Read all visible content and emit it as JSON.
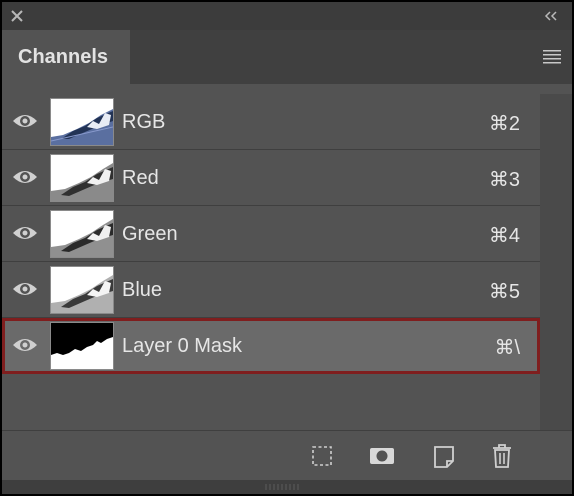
{
  "panel": {
    "tab_label": "Channels",
    "icons": {
      "close": "close-icon",
      "collapse": "double-chevron-left-icon",
      "menu": "hamburger-menu-icon"
    }
  },
  "channels": [
    {
      "name": "RGB",
      "shortcut": "⌘2",
      "visible": true,
      "thumbnail": "color-landscape",
      "selected": false
    },
    {
      "name": "Red",
      "shortcut": "⌘3",
      "visible": true,
      "thumbnail": "grayscale-landscape",
      "selected": false
    },
    {
      "name": "Green",
      "shortcut": "⌘4",
      "visible": true,
      "thumbnail": "grayscale-landscape",
      "selected": false
    },
    {
      "name": "Blue",
      "shortcut": "⌘5",
      "visible": true,
      "thumbnail": "grayscale-landscape",
      "selected": false
    },
    {
      "name": "Layer 0 Mask",
      "shortcut": "⌘\\",
      "visible": true,
      "thumbnail": "mask",
      "selected": true
    }
  ],
  "footer_buttons": [
    {
      "icon": "load-selection-icon"
    },
    {
      "icon": "save-selection-mask-icon"
    },
    {
      "icon": "new-channel-icon"
    },
    {
      "icon": "trash-icon"
    }
  ],
  "colors": {
    "panel_bg": "#535353",
    "selected_row_bg": "#6a6a6a",
    "selected_border": "#7f1e1e",
    "text": "#e6e6e6"
  }
}
